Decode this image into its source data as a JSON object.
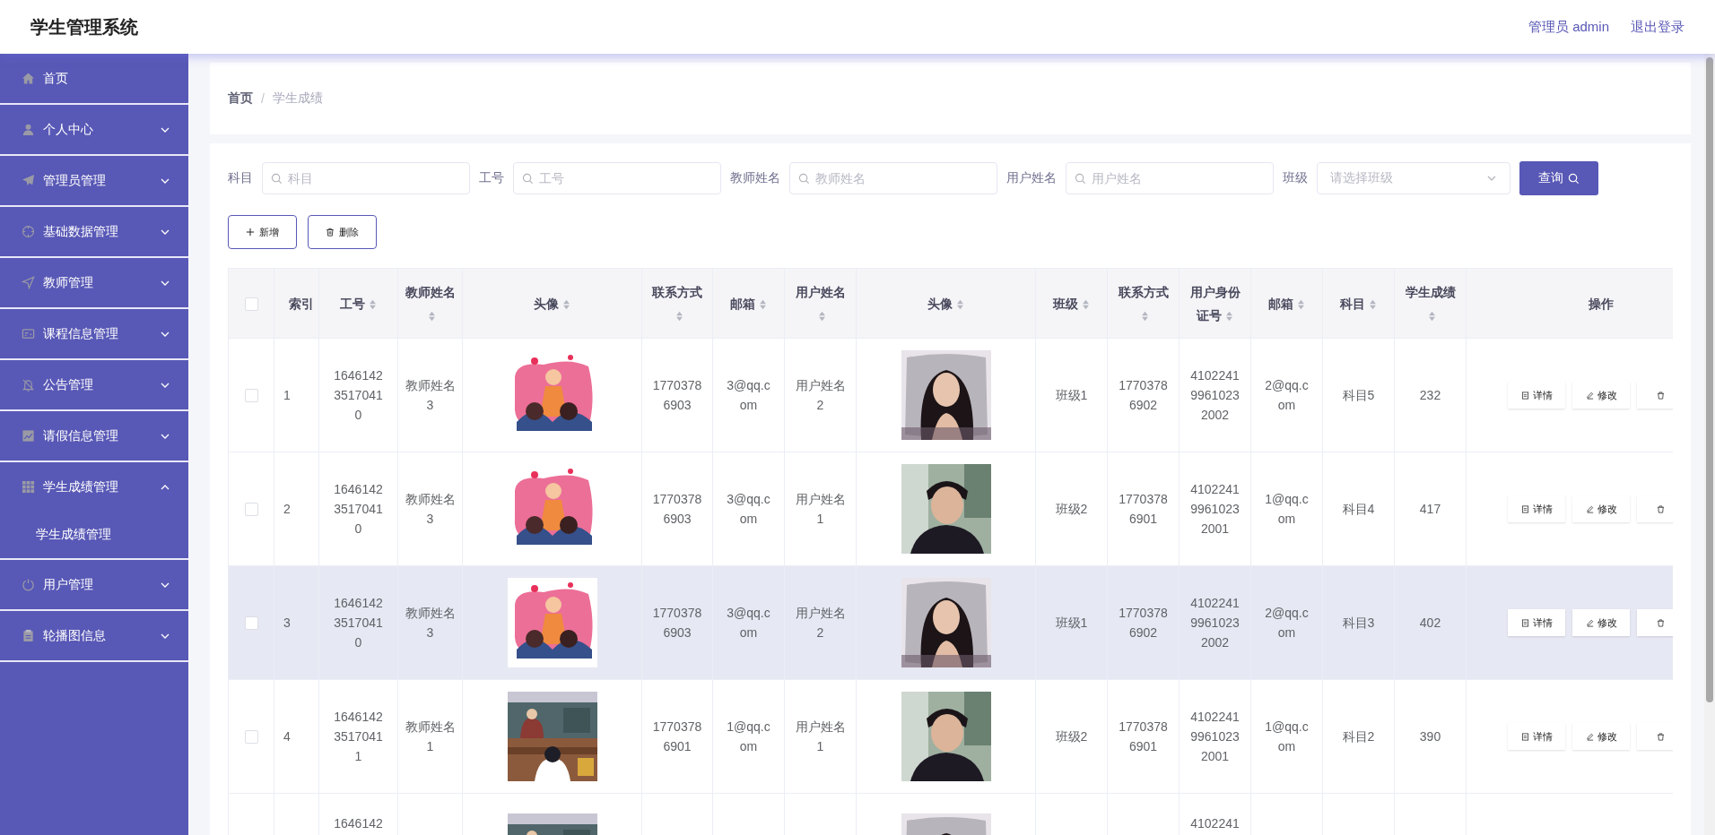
{
  "header": {
    "title": "学生管理系统",
    "user": "管理员 admin",
    "logout": "退出登录"
  },
  "sidebar": {
    "items": [
      {
        "label": "首页",
        "kind": "link"
      },
      {
        "label": "个人中心",
        "kind": "menu",
        "expanded": false
      },
      {
        "label": "管理员管理",
        "kind": "menu",
        "expanded": false
      },
      {
        "label": "基础数据管理",
        "kind": "menu",
        "expanded": false
      },
      {
        "label": "教师管理",
        "kind": "menu",
        "expanded": false
      },
      {
        "label": "课程信息管理",
        "kind": "menu",
        "expanded": false
      },
      {
        "label": "公告管理",
        "kind": "menu",
        "expanded": false
      },
      {
        "label": "请假信息管理",
        "kind": "menu",
        "expanded": false
      },
      {
        "label": "学生成绩管理",
        "kind": "menu",
        "expanded": true,
        "children": [
          {
            "label": "学生成绩管理"
          }
        ]
      },
      {
        "label": "用户管理",
        "kind": "menu",
        "expanded": false
      },
      {
        "label": "轮播图信息",
        "kind": "menu",
        "expanded": false
      }
    ]
  },
  "breadcrumb": {
    "items": [
      "首页",
      "学生成绩"
    ],
    "separator": "/"
  },
  "filters": [
    {
      "label": "科目",
      "kind": "input",
      "placeholder": "科目"
    },
    {
      "label": "工号",
      "kind": "input",
      "placeholder": "工号"
    },
    {
      "label": "教师姓名",
      "kind": "input",
      "placeholder": "教师姓名"
    },
    {
      "label": "用户姓名",
      "kind": "input",
      "placeholder": "用户姓名"
    },
    {
      "label": "班级",
      "kind": "select",
      "placeholder": "请选择班级"
    }
  ],
  "search_button": "查询",
  "toolbar": [
    {
      "label": "新增",
      "kind": "add"
    },
    {
      "label": "删除",
      "kind": "delete"
    }
  ],
  "table": {
    "select_all": {
      "checked": false
    },
    "columns": [
      {
        "label": "索引",
        "kind": "text",
        "sortable": false
      },
      {
        "label": "工号",
        "kind": "text",
        "sortable": true
      },
      {
        "label": "教师姓名",
        "kind": "text",
        "sortable": true
      },
      {
        "label": "头像",
        "sortable": true
      },
      {
        "label": "联系方式",
        "kind": "text",
        "sortable": true
      },
      {
        "label": "邮箱",
        "kind": "text",
        "sortable": true
      },
      {
        "label": "用户姓名",
        "kind": "text",
        "sortable": true
      },
      {
        "label": "头像",
        "sortable": true
      },
      {
        "label": "班级",
        "kind": "text",
        "sortable": true
      },
      {
        "label": "联系方式",
        "kind": "text",
        "sortable": true
      },
      {
        "label": "用户身份证号",
        "kind": "text",
        "sortable": true
      },
      {
        "label": "邮箱",
        "kind": "text",
        "sortable": true
      },
      {
        "label": "科目",
        "kind": "text",
        "sortable": true
      },
      {
        "label": "学生成绩",
        "kind": "text",
        "sortable": true
      },
      {
        "label": "操作",
        "kind": "actions",
        "sortable": false
      }
    ],
    "rows": [
      {
        "checked": false,
        "hovered": false,
        "cells": [
          "1",
          "164614235170410",
          "教师姓名3",
          {
            "kind": "picture"
          },
          "17703786903",
          "3@qq.com",
          "用户姓名2",
          {
            "kind": "picture"
          },
          "班级1",
          "17703786902",
          "410224199610232002",
          "2@qq.com",
          "科目5",
          "232",
          [
            "详情",
            "修改"
          ]
        ]
      },
      {
        "checked": false,
        "hovered": false,
        "cells": [
          "2",
          "164614235170410",
          "教师姓名3",
          {
            "kind": "picture"
          },
          "17703786903",
          "3@qq.com",
          "用户姓名1",
          {
            "kind": "picture"
          },
          "班级2",
          "17703786901",
          "410224199610232001",
          "1@qq.com",
          "科目4",
          "417",
          [
            "详情",
            "修改"
          ]
        ]
      },
      {
        "checked": false,
        "hovered": true,
        "cells": [
          "3",
          "164614235170410",
          "教师姓名3",
          {
            "kind": "picture"
          },
          "17703786903",
          "3@qq.com",
          "用户姓名2",
          {
            "kind": "picture"
          },
          "班级1",
          "17703786902",
          "410224199610232002",
          "2@qq.com",
          "科目3",
          "402",
          [
            "详情",
            "修改"
          ]
        ]
      },
      {
        "checked": false,
        "hovered": false,
        "cells": [
          "4",
          "164614235170411",
          "教师姓名1",
          {
            "kind": "picture"
          },
          "17703786901",
          "1@qq.com",
          "用户姓名1",
          {
            "kind": "picture"
          },
          "班级2",
          "17703786901",
          "410224199610232001",
          "1@qq.com",
          "科目2",
          "390",
          [
            "详情",
            "修改"
          ]
        ]
      },
      {
        "hovered": false,
        "cells": [
          "",
          "1646142",
          "",
          {
            "kind": "picture"
          },
          "",
          "",
          "",
          {
            "kind": "picture"
          },
          "",
          "",
          "4102241",
          "",
          "",
          "",
          []
        ]
      }
    ]
  }
}
